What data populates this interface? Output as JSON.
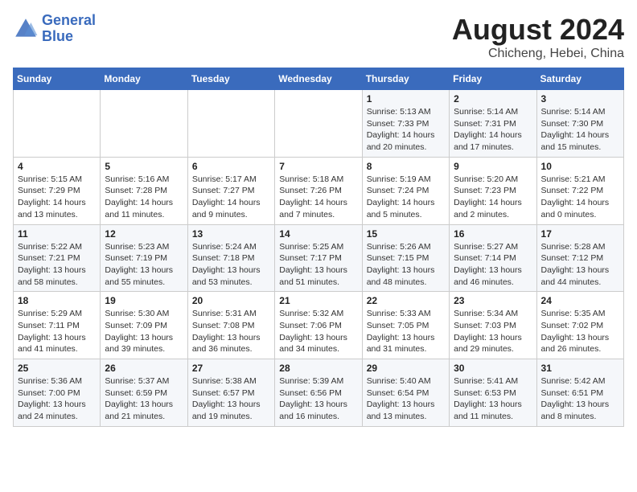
{
  "header": {
    "logo_line1": "General",
    "logo_line2": "Blue",
    "month_year": "August 2024",
    "location": "Chicheng, Hebei, China"
  },
  "weekdays": [
    "Sunday",
    "Monday",
    "Tuesday",
    "Wednesday",
    "Thursday",
    "Friday",
    "Saturday"
  ],
  "weeks": [
    [
      {
        "day": "",
        "info": ""
      },
      {
        "day": "",
        "info": ""
      },
      {
        "day": "",
        "info": ""
      },
      {
        "day": "",
        "info": ""
      },
      {
        "day": "1",
        "info": "Sunrise: 5:13 AM\nSunset: 7:33 PM\nDaylight: 14 hours\nand 20 minutes."
      },
      {
        "day": "2",
        "info": "Sunrise: 5:14 AM\nSunset: 7:31 PM\nDaylight: 14 hours\nand 17 minutes."
      },
      {
        "day": "3",
        "info": "Sunrise: 5:14 AM\nSunset: 7:30 PM\nDaylight: 14 hours\nand 15 minutes."
      }
    ],
    [
      {
        "day": "4",
        "info": "Sunrise: 5:15 AM\nSunset: 7:29 PM\nDaylight: 14 hours\nand 13 minutes."
      },
      {
        "day": "5",
        "info": "Sunrise: 5:16 AM\nSunset: 7:28 PM\nDaylight: 14 hours\nand 11 minutes."
      },
      {
        "day": "6",
        "info": "Sunrise: 5:17 AM\nSunset: 7:27 PM\nDaylight: 14 hours\nand 9 minutes."
      },
      {
        "day": "7",
        "info": "Sunrise: 5:18 AM\nSunset: 7:26 PM\nDaylight: 14 hours\nand 7 minutes."
      },
      {
        "day": "8",
        "info": "Sunrise: 5:19 AM\nSunset: 7:24 PM\nDaylight: 14 hours\nand 5 minutes."
      },
      {
        "day": "9",
        "info": "Sunrise: 5:20 AM\nSunset: 7:23 PM\nDaylight: 14 hours\nand 2 minutes."
      },
      {
        "day": "10",
        "info": "Sunrise: 5:21 AM\nSunset: 7:22 PM\nDaylight: 14 hours\nand 0 minutes."
      }
    ],
    [
      {
        "day": "11",
        "info": "Sunrise: 5:22 AM\nSunset: 7:21 PM\nDaylight: 13 hours\nand 58 minutes."
      },
      {
        "day": "12",
        "info": "Sunrise: 5:23 AM\nSunset: 7:19 PM\nDaylight: 13 hours\nand 55 minutes."
      },
      {
        "day": "13",
        "info": "Sunrise: 5:24 AM\nSunset: 7:18 PM\nDaylight: 13 hours\nand 53 minutes."
      },
      {
        "day": "14",
        "info": "Sunrise: 5:25 AM\nSunset: 7:17 PM\nDaylight: 13 hours\nand 51 minutes."
      },
      {
        "day": "15",
        "info": "Sunrise: 5:26 AM\nSunset: 7:15 PM\nDaylight: 13 hours\nand 48 minutes."
      },
      {
        "day": "16",
        "info": "Sunrise: 5:27 AM\nSunset: 7:14 PM\nDaylight: 13 hours\nand 46 minutes."
      },
      {
        "day": "17",
        "info": "Sunrise: 5:28 AM\nSunset: 7:12 PM\nDaylight: 13 hours\nand 44 minutes."
      }
    ],
    [
      {
        "day": "18",
        "info": "Sunrise: 5:29 AM\nSunset: 7:11 PM\nDaylight: 13 hours\nand 41 minutes."
      },
      {
        "day": "19",
        "info": "Sunrise: 5:30 AM\nSunset: 7:09 PM\nDaylight: 13 hours\nand 39 minutes."
      },
      {
        "day": "20",
        "info": "Sunrise: 5:31 AM\nSunset: 7:08 PM\nDaylight: 13 hours\nand 36 minutes."
      },
      {
        "day": "21",
        "info": "Sunrise: 5:32 AM\nSunset: 7:06 PM\nDaylight: 13 hours\nand 34 minutes."
      },
      {
        "day": "22",
        "info": "Sunrise: 5:33 AM\nSunset: 7:05 PM\nDaylight: 13 hours\nand 31 minutes."
      },
      {
        "day": "23",
        "info": "Sunrise: 5:34 AM\nSunset: 7:03 PM\nDaylight: 13 hours\nand 29 minutes."
      },
      {
        "day": "24",
        "info": "Sunrise: 5:35 AM\nSunset: 7:02 PM\nDaylight: 13 hours\nand 26 minutes."
      }
    ],
    [
      {
        "day": "25",
        "info": "Sunrise: 5:36 AM\nSunset: 7:00 PM\nDaylight: 13 hours\nand 24 minutes."
      },
      {
        "day": "26",
        "info": "Sunrise: 5:37 AM\nSunset: 6:59 PM\nDaylight: 13 hours\nand 21 minutes."
      },
      {
        "day": "27",
        "info": "Sunrise: 5:38 AM\nSunset: 6:57 PM\nDaylight: 13 hours\nand 19 minutes."
      },
      {
        "day": "28",
        "info": "Sunrise: 5:39 AM\nSunset: 6:56 PM\nDaylight: 13 hours\nand 16 minutes."
      },
      {
        "day": "29",
        "info": "Sunrise: 5:40 AM\nSunset: 6:54 PM\nDaylight: 13 hours\nand 13 minutes."
      },
      {
        "day": "30",
        "info": "Sunrise: 5:41 AM\nSunset: 6:53 PM\nDaylight: 13 hours\nand 11 minutes."
      },
      {
        "day": "31",
        "info": "Sunrise: 5:42 AM\nSunset: 6:51 PM\nDaylight: 13 hours\nand 8 minutes."
      }
    ]
  ]
}
